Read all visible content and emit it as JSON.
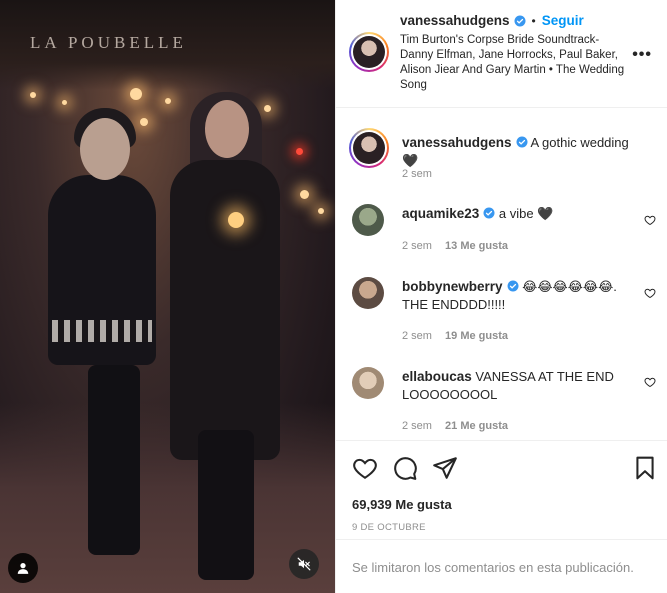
{
  "post": {
    "author": "vanessahudgens",
    "follow_label": "Seguir",
    "separator": "•",
    "audio": "Tim Burton's Corpse Bride Soundtrack- Danny Elfman, Jane Horrocks, Paul Baker, Alison Jiear And Gary Martin • The Wedding Song",
    "more_label": "•••",
    "media_sign": "LA POUBELLE"
  },
  "caption": {
    "username": "vanessahudgens",
    "text": "A gothic wedding🖤",
    "time": "2 sem"
  },
  "comments": [
    {
      "username": "aquamike23",
      "verified": true,
      "text": "a vibe 🖤",
      "time": "2 sem",
      "likes": "13 Me gusta",
      "avatar_color": "#5a6a5a"
    },
    {
      "username": "bobbynewberry",
      "verified": true,
      "text": "😂😂😂😂😂😂. THE ENDDDD!!!!!",
      "time": "2 sem",
      "likes": "19 Me gusta",
      "avatar_color": "#8a6a5a"
    },
    {
      "username": "ellaboucas",
      "verified": false,
      "text": "VANESSA AT THE END LOOOOOOOOL",
      "time": "2 sem",
      "likes": "21 Me gusta",
      "avatar_color": "#b7a08e"
    }
  ],
  "stats": {
    "likes": "69,939 Me gusta",
    "date": "9 DE OCTUBRE"
  },
  "footer": {
    "limited": "Se limitaron los comentarios en esta publicación."
  },
  "colors": {
    "accent": "#0095f6",
    "verified": "#3897f0",
    "muted": "#8e8e8e",
    "text": "#262626"
  }
}
